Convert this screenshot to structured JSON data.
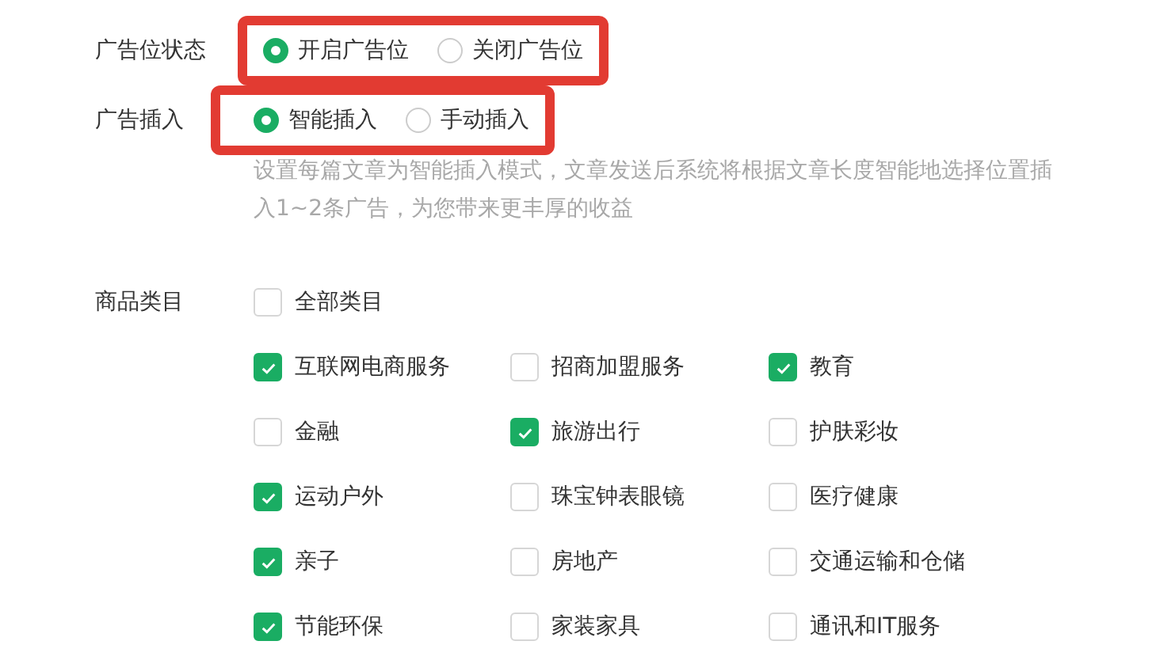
{
  "settings": [
    {
      "label": "广告位状态",
      "highlighted": true,
      "options": [
        {
          "label": "开启广告位",
          "selected": true
        },
        {
          "label": "关闭广告位",
          "selected": false
        }
      ]
    },
    {
      "label": "广告插入",
      "highlighted": true,
      "options": [
        {
          "label": "智能插入",
          "selected": true
        },
        {
          "label": "手动插入",
          "selected": false
        }
      ],
      "hint": "设置每篇文章为智能插入模式，文章发送后系统将根据文章长度智能地选择位置插入1~2条广告，为您带来更丰厚的收益"
    }
  ],
  "categories": {
    "label": "商品类目",
    "all": {
      "label": "全部类目",
      "checked": false
    },
    "items": [
      {
        "label": "互联网电商服务",
        "checked": true
      },
      {
        "label": "招商加盟服务",
        "checked": false
      },
      {
        "label": "教育",
        "checked": true
      },
      {
        "label": "金融",
        "checked": false
      },
      {
        "label": "旅游出行",
        "checked": true
      },
      {
        "label": "护肤彩妆",
        "checked": false
      },
      {
        "label": "运动户外",
        "checked": true
      },
      {
        "label": "珠宝钟表眼镜",
        "checked": false
      },
      {
        "label": "医疗健康",
        "checked": false
      },
      {
        "label": "亲子",
        "checked": true
      },
      {
        "label": "房地产",
        "checked": false
      },
      {
        "label": "交通运输和仓储",
        "checked": false
      },
      {
        "label": "节能环保",
        "checked": true
      },
      {
        "label": "家装家具",
        "checked": false
      },
      {
        "label": "通讯和IT服务",
        "checked": false
      }
    ]
  }
}
